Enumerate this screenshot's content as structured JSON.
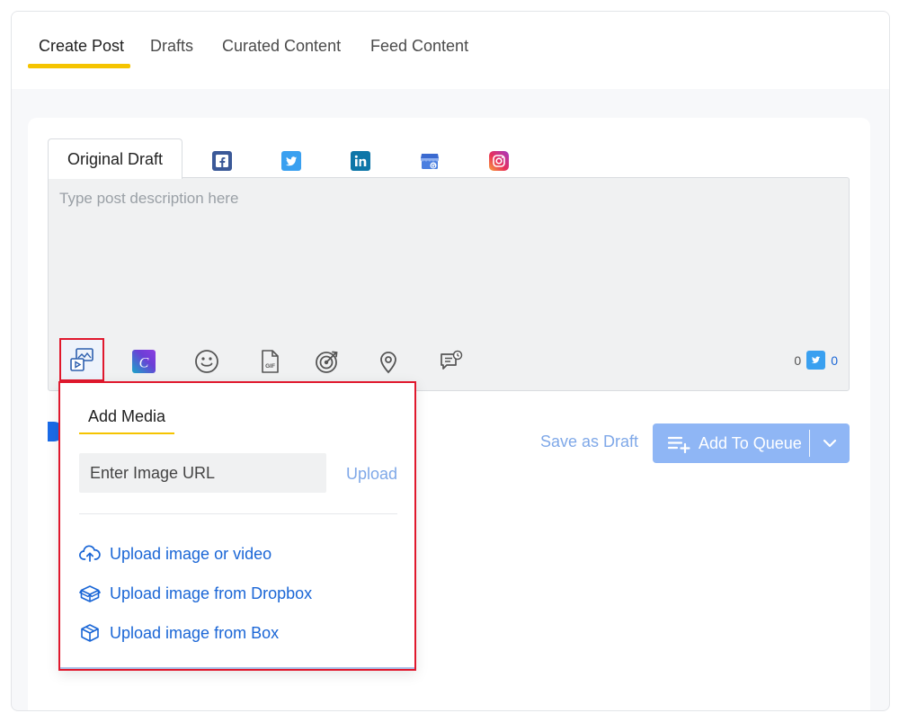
{
  "tabs": [
    {
      "label": "Create Post",
      "active": true
    },
    {
      "label": "Drafts",
      "active": false
    },
    {
      "label": "Curated Content",
      "active": false
    },
    {
      "label": "Feed Content",
      "active": false
    }
  ],
  "composer": {
    "draft_tab_label": "Original Draft",
    "platforms": [
      "facebook-icon",
      "twitter-icon",
      "linkedin-icon",
      "google-business-icon",
      "instagram-icon"
    ],
    "placeholder": "Type post description here",
    "tools": [
      "media-icon",
      "canva-icon",
      "emoji-icon",
      "gif-icon",
      "target-icon",
      "location-icon",
      "comment-schedule-icon"
    ],
    "char_count": "0",
    "twitter_count": "0"
  },
  "actions": {
    "save_draft_label": "Save as Draft",
    "add_to_queue_label": "Add To Queue"
  },
  "media_menu": {
    "title": "Add Media",
    "url_placeholder": "Enter Image URL",
    "upload_label": "Upload",
    "items": [
      {
        "label": "Upload image or video",
        "icon": "cloud-upload-icon"
      },
      {
        "label": "Upload image from Dropbox",
        "icon": "dropbox-icon"
      },
      {
        "label": "Upload image from Box",
        "icon": "box-icon"
      }
    ]
  },
  "colors": {
    "accent": "#f5c400",
    "primary_blue": "#1a66d6",
    "queue_button": "#8fb6f5",
    "highlight_border": "#e0182d"
  }
}
